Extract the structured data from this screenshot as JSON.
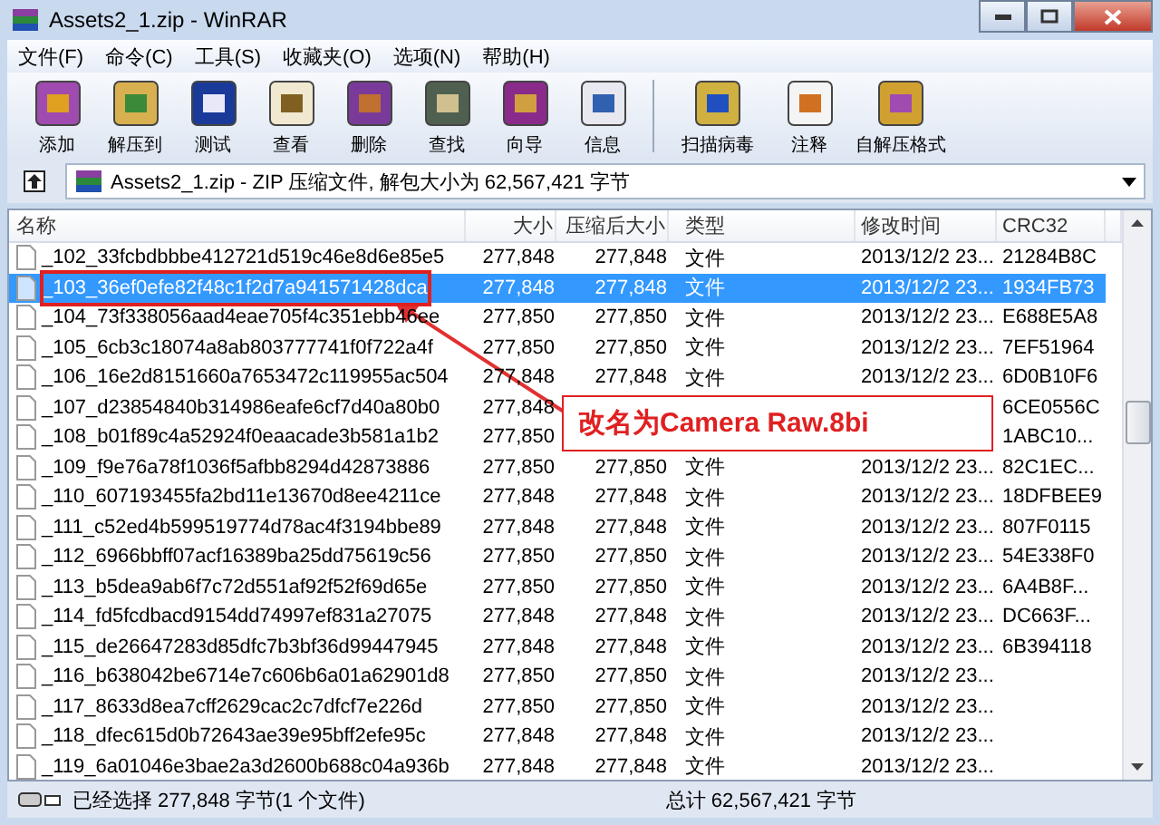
{
  "window": {
    "title": "Assets2_1.zip - WinRAR"
  },
  "menu": [
    "文件(F)",
    "命令(C)",
    "工具(S)",
    "收藏夹(O)",
    "选项(N)",
    "帮助(H)"
  ],
  "toolbar": [
    {
      "label": "添加"
    },
    {
      "label": "解压到"
    },
    {
      "label": "测试"
    },
    {
      "label": "查看"
    },
    {
      "label": "删除"
    },
    {
      "label": "查找"
    },
    {
      "label": "向导"
    },
    {
      "label": "信息"
    },
    {
      "label": "扫描病毒",
      "group_start": true
    },
    {
      "label": "注释"
    },
    {
      "label": "自解压格式"
    }
  ],
  "address": "Assets2_1.zip - ZIP 压缩文件, 解包大小为 62,567,421 字节",
  "table": {
    "columns": [
      "名称",
      "大小",
      "压缩后大小",
      "类型",
      "修改时间",
      "CRC32"
    ],
    "rows": [
      {
        "name": "_102_33fcbdbbbe412721d519c46e8d6e85e5",
        "size": "277,848",
        "packed": "277,848",
        "type": "文件",
        "modified": "2013/12/2 23...",
        "crc": "21284B8C",
        "selected": false
      },
      {
        "name": "_103_36ef0efe82f48c1f2d7a941571428dca",
        "size": "277,848",
        "packed": "277,848",
        "type": "文件",
        "modified": "2013/12/2 23...",
        "crc": "1934FB73",
        "selected": true
      },
      {
        "name": "_104_73f338056aad4eae705f4c351ebb46ee",
        "size": "277,850",
        "packed": "277,850",
        "type": "文件",
        "modified": "2013/12/2 23...",
        "crc": "E688E5A8",
        "selected": false
      },
      {
        "name": "_105_6cb3c18074a8ab803777741f0f722a4f",
        "size": "277,850",
        "packed": "277,850",
        "type": "文件",
        "modified": "2013/12/2 23...",
        "crc": "7EF51964",
        "selected": false
      },
      {
        "name": "_106_16e2d8151660a7653472c119955ac504",
        "size": "277,848",
        "packed": "277,848",
        "type": "文件",
        "modified": "2013/12/2 23...",
        "crc": "6D0B10F6",
        "selected": false
      },
      {
        "name": "_107_d23854840b314986eafe6cf7d40a80b0",
        "size": "277,848",
        "crc": "6CE0556C",
        "selected": false
      },
      {
        "name": "_108_b01f89c4a52924f0eaacade3b581a1b2",
        "size": "277,850",
        "crc": "1ABC10...",
        "selected": false
      },
      {
        "name": "_109_f9e76a78f1036f5afbb8294d42873886",
        "size": "277,850",
        "packed": "277,850",
        "type": "文件",
        "modified": "2013/12/2 23...",
        "crc": "82C1EC...",
        "selected": false
      },
      {
        "name": "_110_607193455fa2bd11e13670d8ee4211ce",
        "size": "277,848",
        "packed": "277,848",
        "type": "文件",
        "modified": "2013/12/2 23...",
        "crc": "18DFBEE9",
        "selected": false
      },
      {
        "name": "_111_c52ed4b599519774d78ac4f3194bbe89",
        "size": "277,848",
        "packed": "277,848",
        "type": "文件",
        "modified": "2013/12/2 23...",
        "crc": "807F0115",
        "selected": false
      },
      {
        "name": "_112_6966bbff07acf16389ba25dd75619c56",
        "size": "277,850",
        "packed": "277,850",
        "type": "文件",
        "modified": "2013/12/2 23...",
        "crc": "54E338F0",
        "selected": false
      },
      {
        "name": "_113_b5dea9ab6f7c72d551af92f52f69d65e",
        "size": "277,850",
        "packed": "277,850",
        "type": "文件",
        "modified": "2013/12/2 23...",
        "crc": "6A4B8F...",
        "selected": false
      },
      {
        "name": "_114_fd5fcdbacd9154dd74997ef831a27075",
        "size": "277,848",
        "packed": "277,848",
        "type": "文件",
        "modified": "2013/12/2 23...",
        "crc": "DC663F...",
        "selected": false
      },
      {
        "name": "_115_de26647283d85dfc7b3bf36d99447945",
        "size": "277,848",
        "packed": "277,848",
        "type": "文件",
        "modified": "2013/12/2 23...",
        "crc": "6B394118",
        "selected": false
      },
      {
        "name": "_116_b638042be6714e7c606b6a01a62901d8",
        "size": "277,850",
        "packed": "277,850",
        "type": "文件",
        "modified": "2013/12/2 23...",
        "selected": false
      },
      {
        "name": "_117_8633d8ea7cff2629cac2c7dfcf7e226d",
        "size": "277,850",
        "packed": "277,850",
        "type": "文件",
        "modified": "2013/12/2 23...",
        "selected": false
      },
      {
        "name": "_118_dfec615d0b72643ae39e95bff2efe95c",
        "size": "277,848",
        "packed": "277,848",
        "type": "文件",
        "modified": "2013/12/2 23...",
        "selected": false
      },
      {
        "name": "_119_6a01046e3bae2a3d2600b688c04a936b",
        "size": "277,848",
        "packed": "277,848",
        "type": "文件",
        "modified": "2013/12/2 23...",
        "selected": false
      }
    ]
  },
  "annotation": {
    "text": "改名为Camera Raw.8bi"
  },
  "status_bar": {
    "left": "已经选择 277,848 字节(1 个文件)",
    "right": "总计 62,567,421 字节"
  }
}
